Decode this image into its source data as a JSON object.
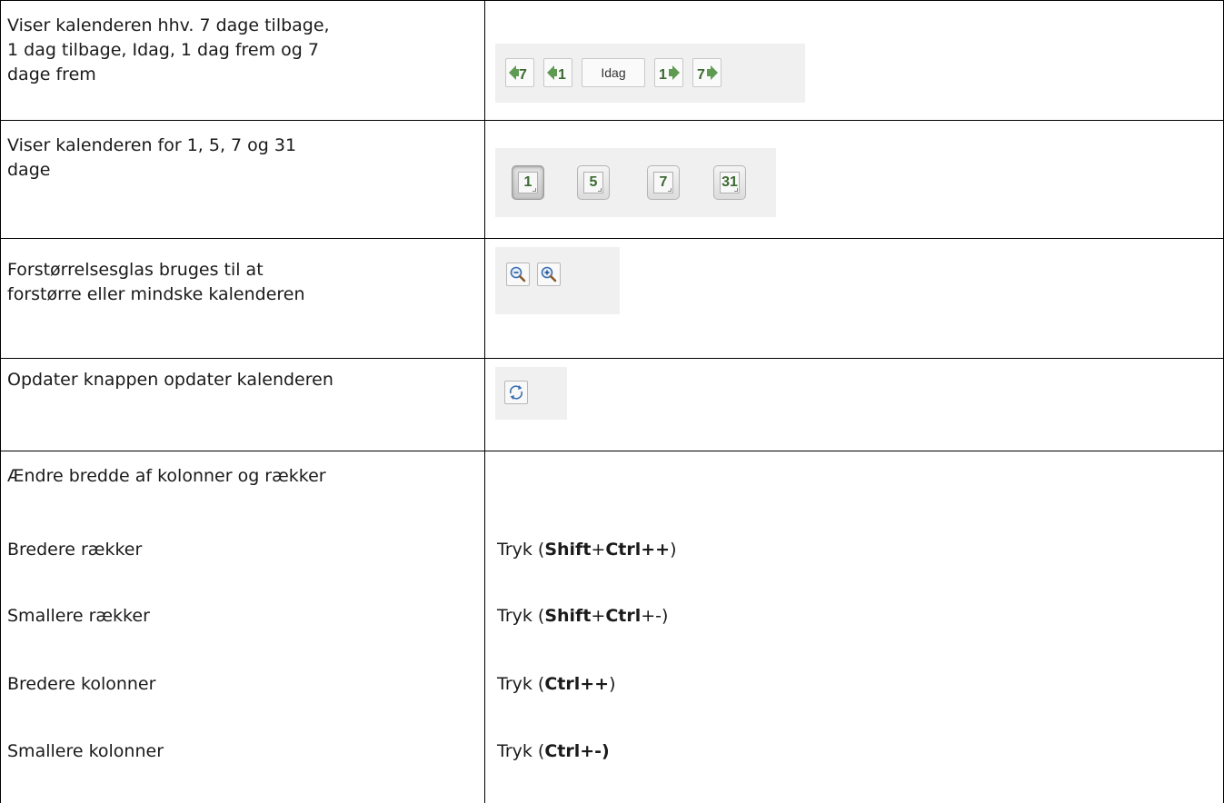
{
  "rows": {
    "navigation": {
      "description_line1": "Viser kalenderen hhv. 7 dage tilbage,",
      "description_line2": "1 dag tilbage, Idag, 1 dag frem og 7",
      "description_line3": "dage frem",
      "buttons": {
        "back7": "back-7-days",
        "back1": "back-1-day",
        "today_label": "Idag",
        "forward1": "forward-1-day",
        "forward7": "forward-7-days"
      }
    },
    "view_days": {
      "description_line1": "Viser kalenderen for 1, 5, 7 og 31",
      "description_line2": "dage",
      "buttons": [
        "1",
        "5",
        "7",
        "31"
      ],
      "active": "1"
    },
    "zoom": {
      "description_line1": "Forstørrelsesglas bruges til at",
      "description_line2": "forstørre eller mindske kalenderen",
      "icons": [
        "zoom-out-icon",
        "zoom-in-icon"
      ]
    },
    "refresh": {
      "description": "Opdater knappen opdater kalenderen",
      "icon": "refresh-icon"
    },
    "resize": {
      "heading": "Ændre bredde af kolonner og rækker",
      "items": [
        {
          "label": "Bredere rækker",
          "prefix": "Tryk (",
          "keys": [
            "Shift",
            "+",
            "Ctrl",
            "++"
          ],
          "suffix": ")"
        },
        {
          "label": "Smallere rækker",
          "prefix": "Tryk (",
          "keys": [
            "Shift",
            "+",
            "Ctrl",
            "+-"
          ],
          "suffix": ")"
        },
        {
          "label": "Bredere kolonner",
          "prefix": "Tryk (",
          "keys": [
            "Ctrl",
            "++"
          ],
          "suffix": ")"
        },
        {
          "label": "Smallere kolonner",
          "prefix": "Tryk (",
          "keys": [
            "Ctrl",
            "+-)"
          ],
          "suffix": ""
        }
      ]
    }
  },
  "colors": {
    "arrow_green": "#5f9a52",
    "digit_green": "#3d6a33",
    "panel_bg": "#f0f0f0"
  }
}
